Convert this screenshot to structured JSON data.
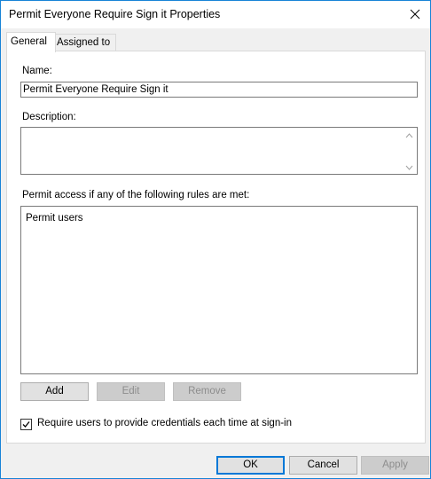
{
  "window": {
    "title": "Permit Everyone Require Sign it Properties"
  },
  "tabs": [
    {
      "label": "General",
      "active": true
    },
    {
      "label": "Assigned to",
      "active": false
    }
  ],
  "general": {
    "name_label": "Name:",
    "name_value": "Permit Everyone Require Sign it",
    "description_label": "Description:",
    "description_value": "",
    "rules_label": "Permit access if any of the following rules are met:",
    "rules": [
      "Permit users"
    ],
    "add_label": "Add",
    "edit_label": "Edit",
    "remove_label": "Remove",
    "require_credentials_label": "Require users to provide credentials each time at sign-in",
    "require_credentials_checked": true
  },
  "footer": {
    "ok_label": "OK",
    "cancel_label": "Cancel",
    "apply_label": "Apply"
  },
  "icons": {
    "close": "close-icon",
    "scroll_up": "scroll-up-arrow-icon",
    "scroll_down": "scroll-down-arrow-icon",
    "check": "checkmark-icon"
  },
  "colors": {
    "window_border": "#1883d7",
    "default_button_border": "#0078d7",
    "disabled_text": "#8d8d8d"
  }
}
